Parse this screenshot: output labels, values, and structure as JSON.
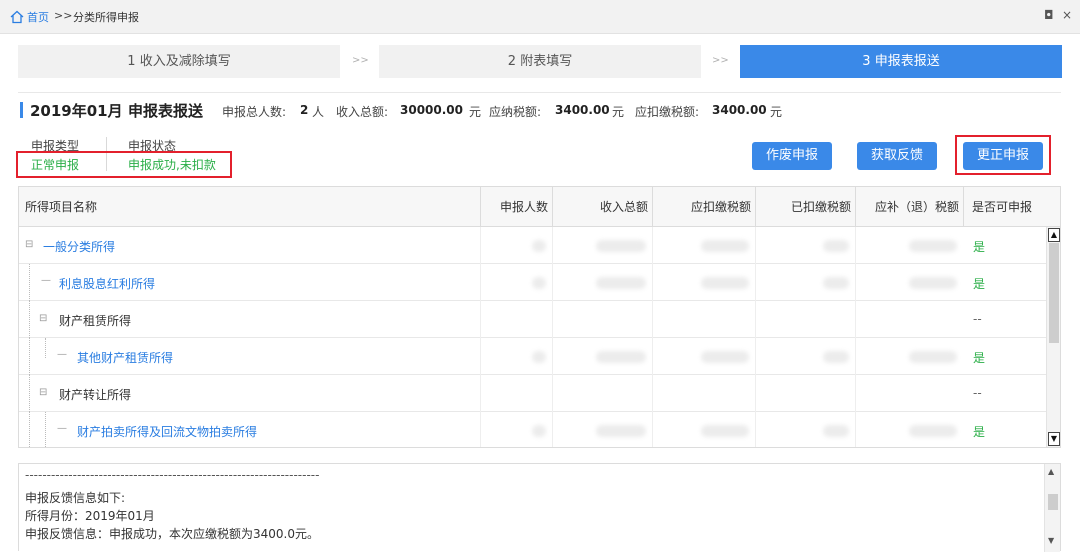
{
  "titlebar": {
    "home": "首页",
    "separator": ">>",
    "current": "分类所得申报",
    "restore": "◘",
    "close": "×"
  },
  "steps": [
    {
      "label": "1 收入及减除填写",
      "active": false
    },
    {
      "label": "2 附表填写",
      "active": false
    },
    {
      "label": "3 申报表报送",
      "active": true
    }
  ],
  "step_arrow": ">>",
  "header": {
    "date": "2019年01月",
    "type": "申报表报送",
    "total_people_label": "申报总人数:",
    "total_people": "2",
    "people_unit": "人",
    "income_label": "收入总额:",
    "income": "30000.00",
    "income_unit": "元",
    "tax_label": "应纳税额:",
    "tax": "3400.00",
    "tax_unit": "元",
    "withhold_label": "应扣缴税额:",
    "withhold": "3400.00",
    "withhold_unit": "元"
  },
  "status": {
    "type_label": "申报类型",
    "type_value": "正常申报",
    "state_label": "申报状态",
    "state_value": "申报成功,未扣款"
  },
  "buttons": {
    "void": "作废申报",
    "feedback": "获取反馈",
    "correct": "更正申报"
  },
  "table": {
    "columns": [
      "所得项目名称",
      "申报人数",
      "收入总额",
      "应扣缴税额",
      "已扣缴税额",
      "应补（退）税额",
      "是否可申报"
    ],
    "rows": [
      {
        "name": "一般分类所得",
        "can_declare": "是"
      },
      {
        "name": "利息股息红利所得",
        "can_declare": "是"
      },
      {
        "name": "财产租赁所得",
        "can_declare": "--"
      },
      {
        "name": "其他财产租赁所得",
        "can_declare": "是"
      },
      {
        "name": "财产转让所得",
        "can_declare": "--"
      },
      {
        "name": "财产拍卖所得及回流文物拍卖所得",
        "can_declare": "是"
      }
    ]
  },
  "feedback": {
    "divider": "--------------------------------------------------------------------",
    "title": "申报反馈信息如下:",
    "month": "所得月份：2019年01月",
    "message": "申报反馈信息：申报成功，本次应缴税额为3400.0元。"
  },
  "colors": {
    "accent": "#3a89e8",
    "link": "#2a7de1",
    "success": "#2aae47",
    "highlight": "#e3202c"
  }
}
